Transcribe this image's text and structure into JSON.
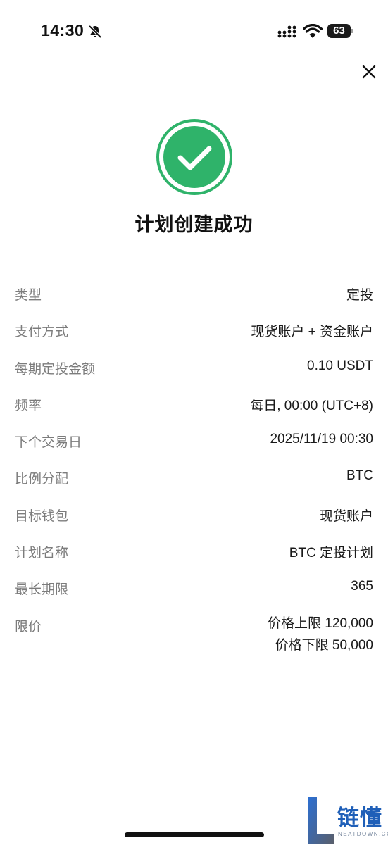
{
  "status_bar": {
    "time": "14:30",
    "battery": "63",
    "icons": [
      "bell-slash-icon",
      "cellular-signal-icon",
      "wifi-icon",
      "battery-icon"
    ]
  },
  "header": {
    "close_icon": "close-icon",
    "success_icon": "check-circle-icon",
    "title": "计划创建成功"
  },
  "colors": {
    "success_green": "#2fb36a",
    "label_gray": "#7c7c7c",
    "watermark_blue": "#1f5fb8"
  },
  "details": [
    {
      "label": "类型",
      "value": "定投"
    },
    {
      "label": "支付方式",
      "value": "现货账户 + 资金账户"
    },
    {
      "label": "每期定投金额",
      "value": "0.10 USDT"
    },
    {
      "label": "频率",
      "value": "每日, 00:00 (UTC+8)"
    },
    {
      "label": "下个交易日",
      "value": "2025/11/19 00:30"
    },
    {
      "label": "比例分配",
      "value": "BTC"
    },
    {
      "label": "目标钱包",
      "value": "现货账户"
    },
    {
      "label": "计划名称",
      "value": "BTC 定投计划"
    },
    {
      "label": "最长期限",
      "value": "365"
    },
    {
      "label": "限价",
      "value": "价格上限 120,000",
      "value2": "价格下限 50,000"
    }
  ],
  "watermark": {
    "text": "链懂",
    "sub": "NEATDOWN.COM"
  }
}
